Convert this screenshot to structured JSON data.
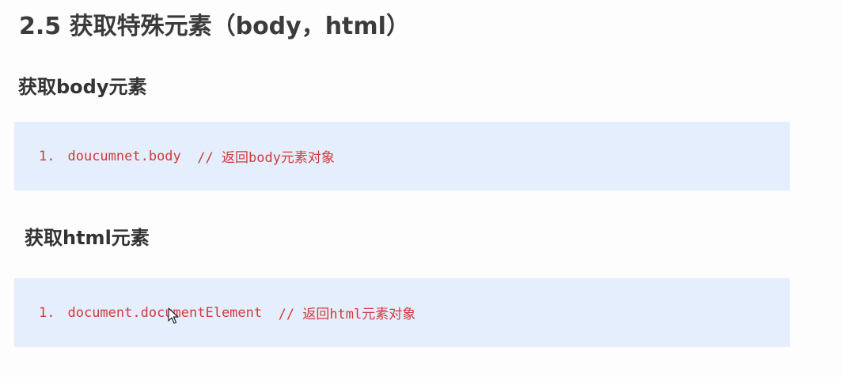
{
  "page": {
    "title": "2.5 获取特殊元素（body，html）"
  },
  "sections": [
    {
      "heading": "获取body元素",
      "code": {
        "line_number": "1.",
        "statement": "doucumnet.body",
        "comment": "// 返回body元素对象"
      }
    },
    {
      "heading": "获取html元素",
      "code": {
        "line_number": "1.",
        "statement": "document.documentElement",
        "comment": "// 返回html元素对象"
      }
    }
  ],
  "colors": {
    "code_text": "#d4393b",
    "code_background": "#e5eefc",
    "heading_text": "#333333"
  },
  "icons": {
    "pointer": "mouse-pointer-icon"
  }
}
